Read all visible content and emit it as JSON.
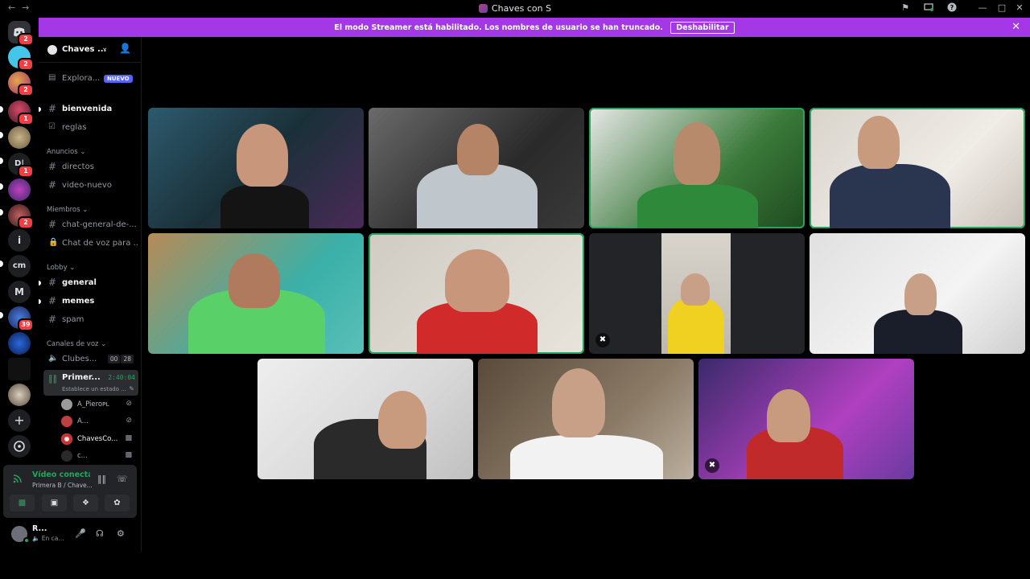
{
  "window": {
    "title": "Chaves con S",
    "back": "←",
    "forward": "→"
  },
  "banner": {
    "text": "El modo Streamer está habilitado. Los nombres de usuario se han truncado.",
    "button": "Deshabilitar",
    "close": "✕"
  },
  "rail": {
    "badges": [
      "2",
      "2",
      "2",
      "1",
      "1",
      "2",
      "39"
    ],
    "letters": [
      "i",
      "cm",
      "M"
    ]
  },
  "server": {
    "name": "Chaves ...",
    "explore": "Explora...",
    "explore_badge": "NUEVO"
  },
  "channels": {
    "top": [
      "bienvenida",
      "reglas"
    ],
    "cat_anuncios": "Anuncios",
    "anuncios": [
      "directos",
      "video-nuevo"
    ],
    "cat_miembros": "Miembros",
    "miembros": [
      "chat-general-de-...",
      "Chat de voz para ..."
    ],
    "cat_lobby": "Lobby",
    "lobby": [
      "general",
      "memes",
      "spam"
    ],
    "cat_voz": "Canales de voz",
    "voz_clubes": "Clubes...",
    "voz_clubes_counts": [
      "00",
      "28"
    ]
  },
  "active_voice": {
    "name": "Primer...",
    "time": "2:40:04",
    "status": "Establece un estado ...",
    "users": [
      "A_Pieroᴘʟ",
      "A...",
      "ChavesCo...",
      "c..."
    ]
  },
  "voice_panel": {
    "title": "Vídeo conectad",
    "subtitle": "Primera B / Chave..."
  },
  "user_panel": {
    "name": "R...",
    "status": "En ca..."
  },
  "colors": {
    "accent": "#a437e6",
    "online": "#23a55a",
    "badge": "#f23f43",
    "brand": "#5865f2"
  }
}
